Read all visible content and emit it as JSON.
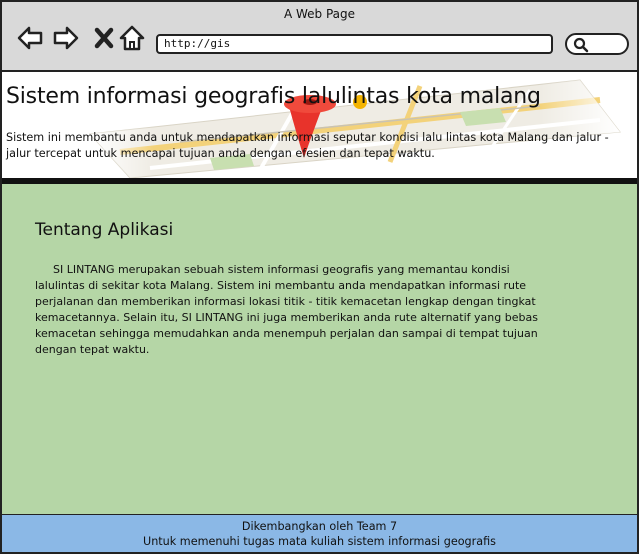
{
  "browser": {
    "window_title": "A Web Page",
    "url": "http://gis"
  },
  "header": {
    "title": "Sistem informasi geografis lalulintas kota malang",
    "description": "Sistem ini membantu anda untuk mendapatkan informasi seputar kondisi lalu lintas kota Malang dan jalur - jalur tercepat untuk mencapai tujuan anda dengan efesien dan tepat waktu."
  },
  "about": {
    "heading": "Tentang Aplikasi",
    "body": "SI LINTANG merupakan sebuah sistem informasi geografis yang memantau kondisi lalulintas di sekitar kota Malang. Sistem ini membantu anda mendapatkan informasi rute perjalanan dan memberikan informasi lokasi titik - titik kemacetan lengkap dengan tingkat kemacetannya. Selain itu, SI LINTANG ini juga memberikan anda rute alternatif yang bebas kemacetan sehingga memudahkan anda menempuh perjalan dan sampai di tempat tujuan dengan tepat waktu."
  },
  "footer": {
    "line1": "Dikembangkan oleh Team 7",
    "line2": "Untuk memenuhi tugas mata kuliah sistem informasi geografis"
  },
  "icons": {
    "back": "back-arrow-icon",
    "forward": "forward-arrow-icon",
    "stop": "close-icon",
    "home": "home-icon",
    "search": "search-icon",
    "header_image": "map-pin-image"
  },
  "colors": {
    "main_bg": "#b5d6a6",
    "footer_bg": "#8bb8e6",
    "pin": "#e8332b"
  }
}
